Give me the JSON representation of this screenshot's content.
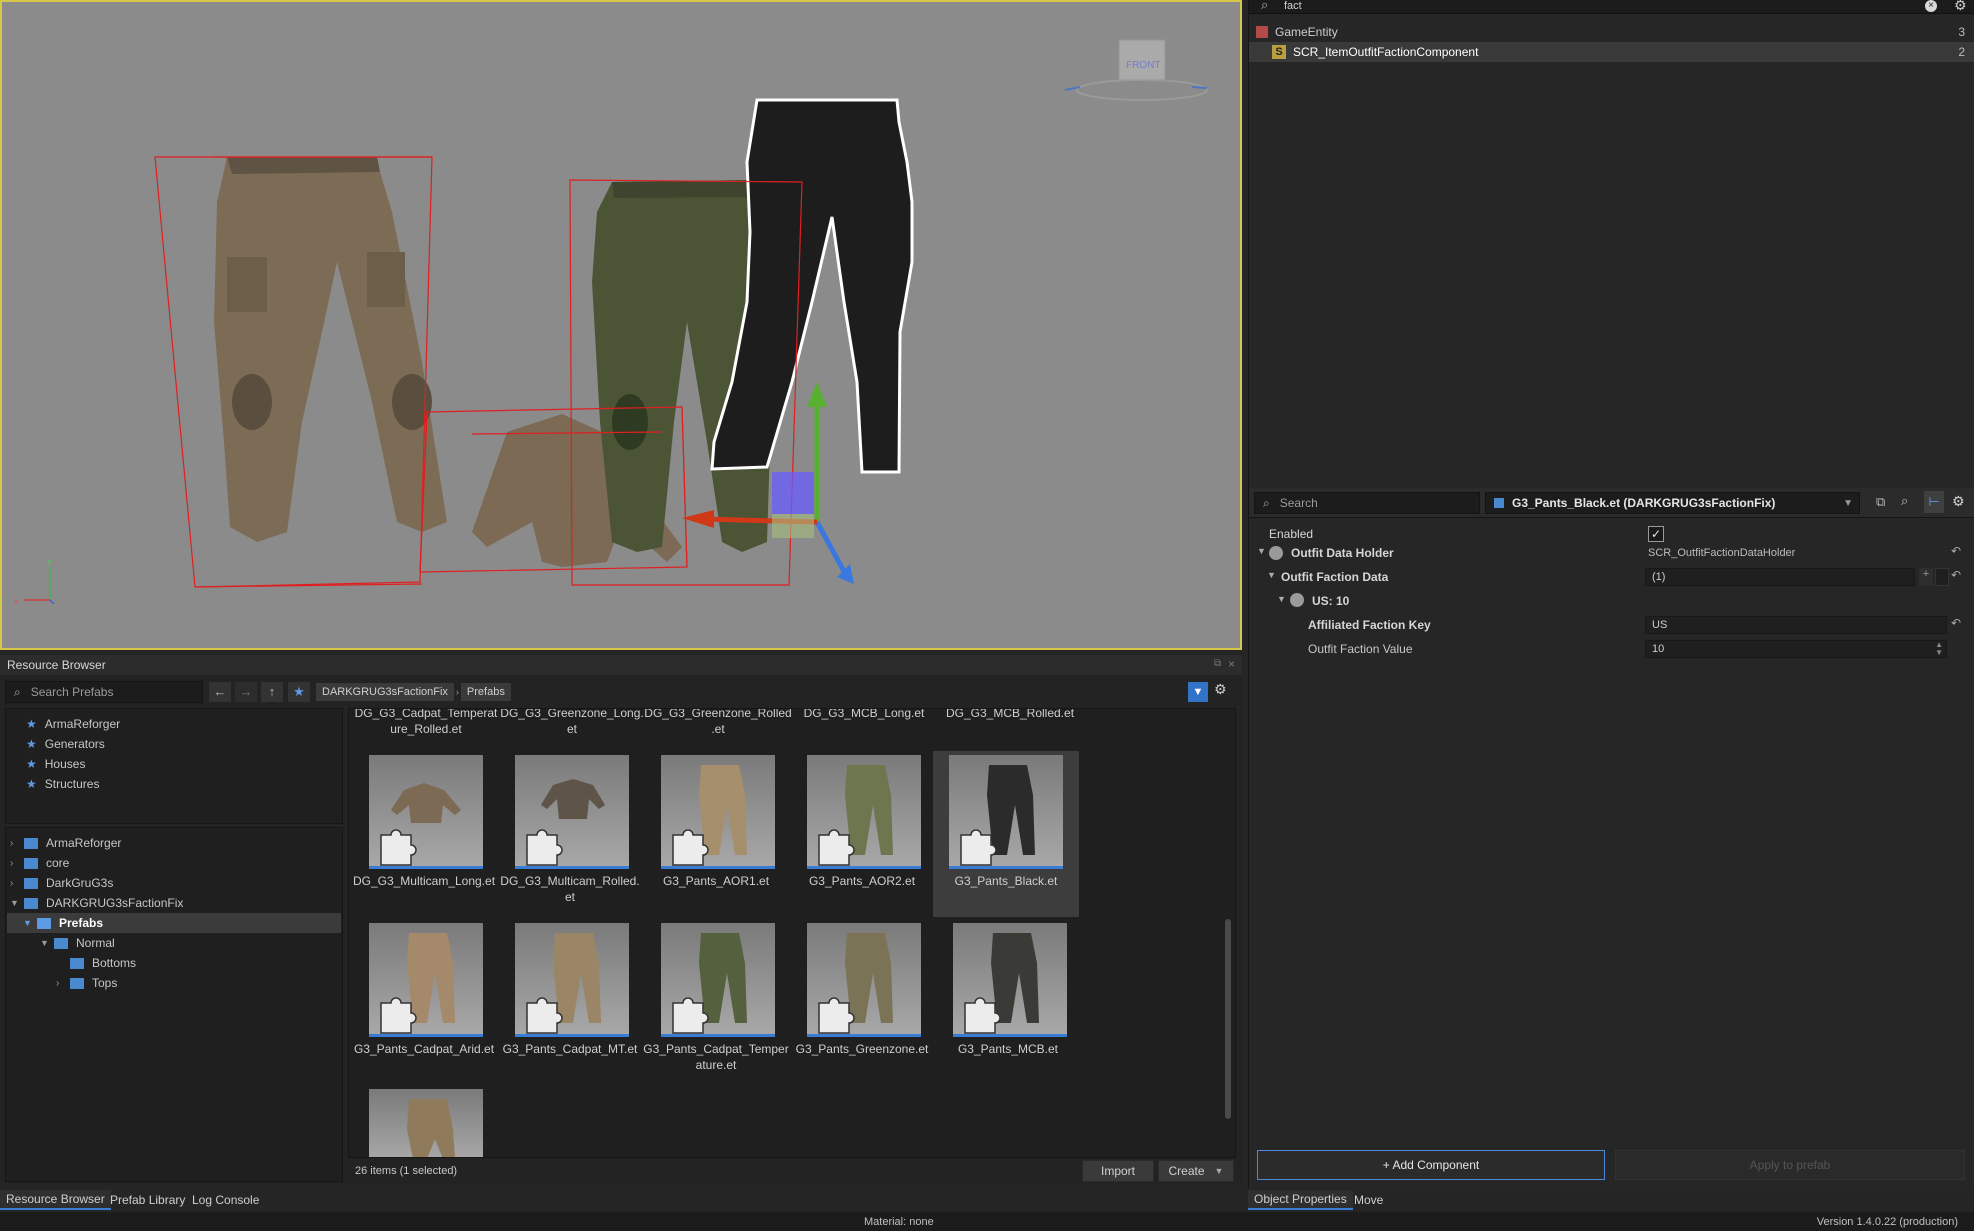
{
  "hierarchy": {
    "search_value": "fact",
    "rows": [
      {
        "label": "GameEntity",
        "count": "3"
      },
      {
        "label": "SCR_ItemOutfitFactionComponent",
        "count": "2"
      }
    ]
  },
  "viewport": {
    "gizmo_label": "FRONT",
    "axis_y": "y",
    "axis_x": "x"
  },
  "properties": {
    "search_placeholder": "Search",
    "entity_name": "G3_Pants_Black.et (DARKGRUG3sFactionFix)",
    "rows": {
      "enabled": "Enabled",
      "outfit_data_holder": "Outfit Data Holder",
      "outfit_data_holder_value": "SCR_OutfitFactionDataHolder",
      "outfit_faction_data": "Outfit Faction Data",
      "outfit_faction_data_value": "(1)",
      "us_entry": "US: 10",
      "affiliated_key": "Affiliated Faction Key",
      "affiliated_key_value": "US",
      "outfit_value": "Outfit Faction Value",
      "outfit_value_value": "10"
    },
    "add_component": "+ Add Component",
    "apply_to_prefab": "Apply to prefab"
  },
  "resource_browser": {
    "title": "Resource Browser",
    "search_placeholder": "Search Prefabs",
    "breadcrumb": [
      "DARKGRUG3sFactionFix",
      "Prefabs"
    ],
    "favorites": [
      "ArmaReforger",
      "Generators",
      "Houses",
      "Structures"
    ],
    "tree": [
      "ArmaReforger",
      "core",
      "DarkGruG3s",
      "DARKGRUG3sFactionFix",
      "Prefabs",
      "Normal",
      "Bottoms",
      "Tops"
    ],
    "top_row_labels": [
      "DG_G3_Cadpat_Temperat\nure_Rolled.et",
      "DG_G3_Greenzone_Long.\net",
      "DG_G3_Greenzone_Rolled\n.et",
      "DG_G3_MCB_Long.et",
      "DG_G3_MCB_Rolled.et"
    ],
    "items": [
      "DG_G3_Multicam_Long.et",
      "DG_G3_Multicam_Rolled.\net",
      "G3_Pants_AOR1.et",
      "G3_Pants_AOR2.et",
      "G3_Pants_Black.et",
      "G3_Pants_Cadpat_Arid.et",
      "G3_Pants_Cadpat_MT.et",
      "G3_Pants_Cadpat_Temper\nature.et",
      "G3_Pants_Greenzone.et",
      "G3_Pants_MCB.et"
    ],
    "status": "26 items (1 selected)",
    "import_label": "Import",
    "create_label": "Create"
  },
  "bottom_tabs_left": [
    "Resource Browser",
    "Prefab Library",
    "Log Console"
  ],
  "bottom_tabs_right": [
    "Object Properties",
    "Move"
  ],
  "status_material": "Material: none",
  "status_version": "Version 1.4.0.22 (production)"
}
